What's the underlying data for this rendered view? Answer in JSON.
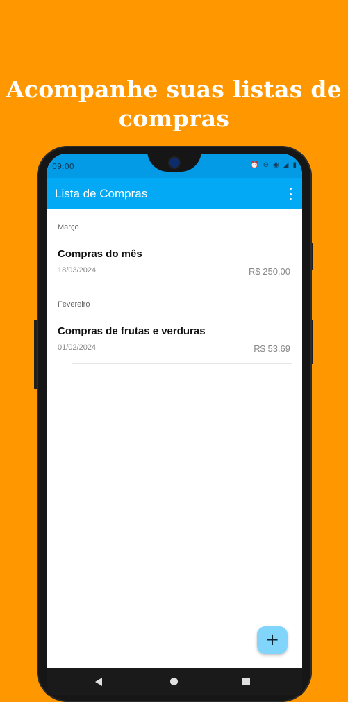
{
  "headline": {
    "line1": "Acompanhe suas listas de",
    "line2": "compras"
  },
  "statusbar": {
    "time": "09:00",
    "icons": [
      "alarm-icon",
      "dnd-icon",
      "hotspot-icon",
      "signal-icon",
      "battery-icon"
    ]
  },
  "appbar": {
    "title": "Lista de Compras",
    "menu_icon": "more-vert-icon"
  },
  "groups": [
    {
      "month": "Março",
      "items": [
        {
          "title": "Compras do mês",
          "date": "18/03/2024",
          "value": "R$ 250,00"
        }
      ]
    },
    {
      "month": "Fevereiro",
      "items": [
        {
          "title": "Compras de frutas e verduras",
          "date": "01/02/2024",
          "value": "R$ 53,69"
        }
      ]
    }
  ],
  "fab": {
    "label": "+"
  },
  "navbar": {
    "icons": [
      "back-icon",
      "home-icon",
      "recent-apps-icon"
    ]
  },
  "colors": {
    "background": "#FF9800",
    "appbar": "#03A9F4",
    "statusbar": "#039BE5",
    "fab": "#81D4FA"
  }
}
